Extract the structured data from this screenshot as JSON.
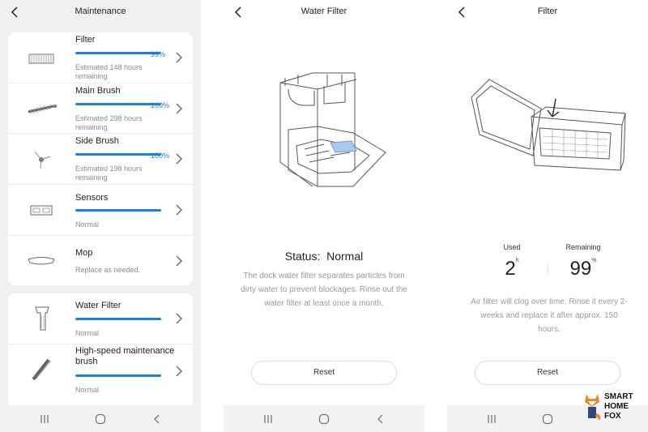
{
  "maintenance": {
    "title": "Maintenance",
    "items": [
      {
        "name": "Filter",
        "percent": 99,
        "percent_label": "99%",
        "sub": "Estimated 148 hours remaining",
        "icon": "filter-icon"
      },
      {
        "name": "Main Brush",
        "percent": 100,
        "percent_label": "100%",
        "sub": "Estimated 298 hours remaining",
        "icon": "main-brush-icon"
      },
      {
        "name": "Side Brush",
        "percent": 100,
        "percent_label": "100%",
        "sub": "Estimated 198 hours remaining",
        "icon": "side-brush-icon"
      },
      {
        "name": "Sensors",
        "percent": 100,
        "sub": "Normal",
        "icon": "sensors-icon"
      },
      {
        "name": "Mop",
        "sub": "Replace as needed.",
        "icon": "mop-icon"
      }
    ],
    "items2": [
      {
        "name": "Water Filter",
        "percent": 100,
        "sub": "Normal",
        "icon": "water-filter-icon"
      },
      {
        "name": "High-speed maintenance brush",
        "percent": 100,
        "sub": "Normal",
        "icon": "maintenance-brush-icon"
      }
    ]
  },
  "water_filter": {
    "title": "Water Filter",
    "status_label": "Status:",
    "status_value": "Normal",
    "description": "The dock water filter separates particles from dirty water to prevent blockages. Rinse out the water filter at least once a month.",
    "reset_label": "Reset"
  },
  "filter": {
    "title": "Filter",
    "used_label": "Used",
    "used_value": "2",
    "used_unit": "h",
    "remaining_label": "Remaining",
    "remaining_value": "99",
    "remaining_unit": "%",
    "description": "Air filter will clog over time. Rinse it every 2-weeks and replace it after approx. 150 hours.",
    "reset_label": "Reset"
  },
  "brand": {
    "line1": "SMART",
    "line2": "HOME",
    "line3": "FOX"
  },
  "colors": {
    "accent": "#1a82d8",
    "background": "#f0f0f2",
    "muted_text": "#999999"
  }
}
